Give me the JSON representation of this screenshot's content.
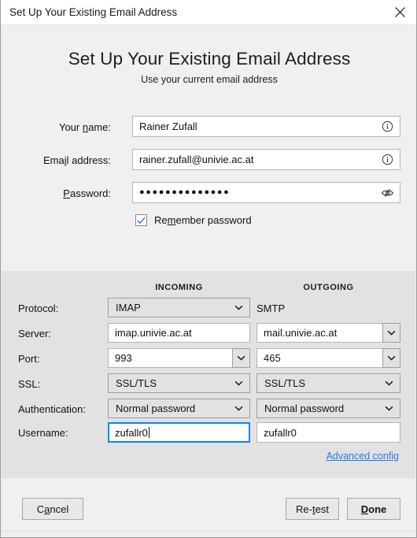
{
  "window": {
    "title": "Set Up Your Existing Email Address",
    "close_icon": "close-icon"
  },
  "header": {
    "title": "Set Up Your Existing Email Address",
    "subtitle": "Use your current email address"
  },
  "account": {
    "name_label_pre": "Your ",
    "name_label_key": "n",
    "name_label_post": "ame:",
    "name_value": "Rainer Zufall",
    "name_info_icon": "info-circle-icon",
    "email_label_pre": "Ema",
    "email_label_key": "i",
    "email_label_post": "l address:",
    "email_value": "rainer.zufall@univie.ac.at",
    "email_info_icon": "info-circle-icon",
    "password_label_key": "P",
    "password_label_post": "assword:",
    "password_value": "●●●●●●●●●●●●●●",
    "password_reveal_icon": "eye-slash-icon",
    "remember_pre": "Re",
    "remember_key": "m",
    "remember_post": "ember password",
    "remember_checked": true
  },
  "server": {
    "col_incoming": "INCOMING",
    "col_outgoing": "OUTGOING",
    "rows": [
      {
        "label": "Protocol:",
        "incoming": {
          "kind": "select",
          "value": "IMAP"
        },
        "outgoing": {
          "kind": "text",
          "value": "SMTP"
        }
      },
      {
        "label": "Server:",
        "incoming": {
          "kind": "input",
          "value": "imap.univie.ac.at"
        },
        "outgoing": {
          "kind": "combo",
          "value": "mail.univie.ac.at"
        }
      },
      {
        "label": "Port:",
        "incoming": {
          "kind": "combo",
          "value": "993"
        },
        "outgoing": {
          "kind": "combo",
          "value": "465"
        }
      },
      {
        "label": "SSL:",
        "incoming": {
          "kind": "select",
          "value": "SSL/TLS"
        },
        "outgoing": {
          "kind": "select",
          "value": "SSL/TLS"
        }
      },
      {
        "label": "Authentication:",
        "incoming": {
          "kind": "select",
          "value": "Normal password"
        },
        "outgoing": {
          "kind": "select",
          "value": "Normal password"
        }
      },
      {
        "label": "Username:",
        "incoming": {
          "kind": "input",
          "value": "zufallr0",
          "focused": true
        },
        "outgoing": {
          "kind": "input",
          "value": "zufallr0"
        }
      }
    ],
    "advanced_config": "Advanced config"
  },
  "footer": {
    "cancel_pre": "C",
    "cancel_key": "a",
    "cancel_post": "ncel",
    "retest_pre": "Re-",
    "retest_key": "t",
    "retest_post": "est",
    "done_key": "D",
    "done_post": "one"
  },
  "colors": {
    "accent_link": "#2a7ae2",
    "focus_border": "#0a84ff",
    "check_mark": "#2a7ae2",
    "panel_bg": "#e2e2e2",
    "window_bg": "#f0f0f0"
  }
}
